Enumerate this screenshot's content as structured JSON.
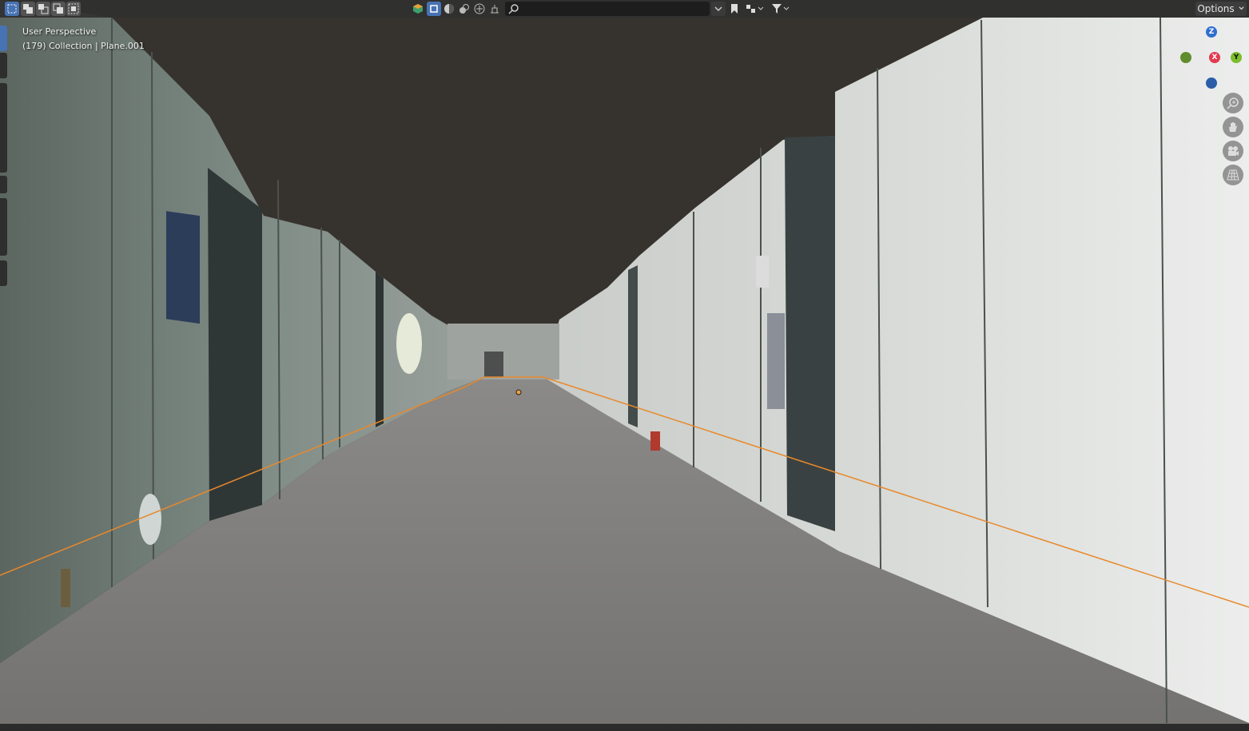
{
  "overlay": {
    "view_name": "User Perspective",
    "context": "(179) Collection | Plane.001"
  },
  "header": {
    "options_label": "Options",
    "search_placeholder": ""
  },
  "gizmo": {
    "z_label": "Z",
    "x_label": "X",
    "y_label": "Y"
  },
  "colors": {
    "accent": "#4772b3",
    "selection_outline": "#e8892b",
    "ceiling": "#36322d",
    "floor": "#7a7978"
  },
  "icons": {
    "select_modes": [
      "select-box-icon",
      "mode-extend-icon",
      "mode-subtract-icon",
      "mode-difference-icon",
      "mode-intersect-icon"
    ],
    "display_filters": [
      "object-type-icon",
      "selectable-icon",
      "viewport-shading-icon",
      "overlay-icon",
      "visibility-icon",
      "layout-icon"
    ],
    "gizmo_tools": [
      "zoom-icon",
      "pan-hand-icon",
      "camera-icon",
      "grid-view-icon"
    ]
  }
}
